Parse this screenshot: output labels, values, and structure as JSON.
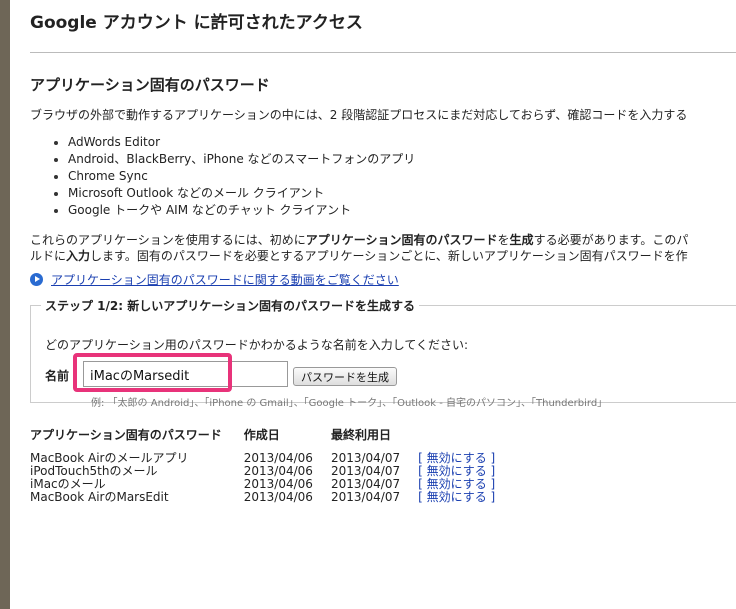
{
  "page": {
    "title": "Google アカウント に許可されたアクセス",
    "section_title": "アプリケーション固有のパスワード",
    "intro": "ブラウザの外部で動作するアプリケーションの中には、2 段階認証プロセスにまだ対応しておらず、確認コードを入力する"
  },
  "apps": [
    "AdWords Editor",
    "Android、BlackBerry、iPhone などのスマートフォンのアプリ",
    "Chrome Sync",
    "Microsoft Outlook などのメール クライアント",
    "Google トークや AIM などのチャット クライアント"
  ],
  "para": {
    "line1_a": "これらのアプリケーションを使用するには、初めに",
    "line1_b": "アプリケーション固有のパスワード",
    "line1_c": "を",
    "line1_d": "生成",
    "line1_e": "する必要があります。このパ",
    "line2_a": "ルドに",
    "line2_b": "入力",
    "line2_c": "します。固有のパスワードを必要とするアプリケーションごとに、新しいアプリケーション固有パスワードを作"
  },
  "video_link": "アプリケーション固有のパスワードに関する動画をご覧ください",
  "step": {
    "legend": "ステップ 1/2: 新しいアプリケーション固有のパスワードを生成する",
    "description": "どのアプリケーション用のパスワードかわかるような名前を入力してください:",
    "name_label": "名前",
    "name_value": "iMacのMarsedit",
    "generate_button": "パスワードを生成",
    "example": "例: 「太郎の Android」、「iPhone の Gmail」、「Google トーク」、「Outlook - 自宅のパソコン」、「Thunderbird」"
  },
  "table": {
    "headers": [
      "アプリケーション固有のパスワード",
      "作成日",
      "最終利用日"
    ],
    "rows": [
      {
        "name": "MacBook Airのメールアプリ",
        "created": "2013/04/06",
        "last_used": "2013/04/07",
        "action": "[ 無効にする ]"
      },
      {
        "name": "iPodTouch5thのメール",
        "created": "2013/04/06",
        "last_used": "2013/04/07",
        "action": "[ 無効にする ]"
      },
      {
        "name": "iMacのメール",
        "created": "2013/04/06",
        "last_used": "2013/04/07",
        "action": "[ 無効にする ]"
      },
      {
        "name": "MacBook AirのMarsEdit",
        "created": "2013/04/06",
        "last_used": "2013/04/07",
        "action": "[ 無効にする ]"
      }
    ]
  },
  "colors": {
    "link": "#1a3fb0",
    "highlight": "#e8337a"
  },
  "icons": {
    "video": "play-circle-icon"
  }
}
